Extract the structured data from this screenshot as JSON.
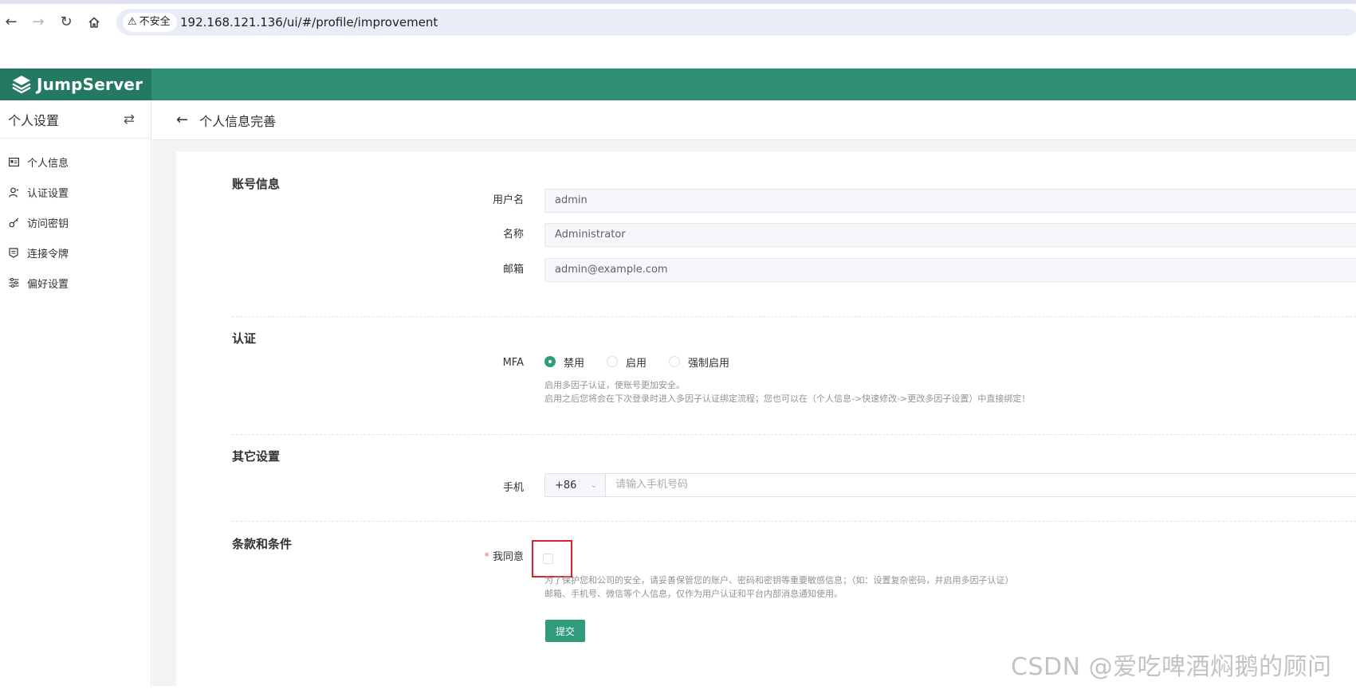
{
  "browser": {
    "insecure_label": "不安全",
    "url": "192.168.121.136/ui/#/profile/improvement"
  },
  "app": {
    "logo_text": "JumpServer",
    "colors": {
      "header": "#2f8f74",
      "logo_bg": "#247a61",
      "accent": "#2f9c7c",
      "highlight": "#e0202a"
    }
  },
  "sidebar": {
    "title": "个人设置",
    "items": [
      {
        "label": "个人信息",
        "icon": "id-card-icon"
      },
      {
        "label": "认证设置",
        "icon": "user-auth-icon"
      },
      {
        "label": "访问密钥",
        "icon": "key-icon"
      },
      {
        "label": "连接令牌",
        "icon": "token-icon"
      },
      {
        "label": "偏好设置",
        "icon": "sliders-icon"
      }
    ]
  },
  "page": {
    "title": "个人信息完善"
  },
  "account": {
    "section_title": "账号信息",
    "username_label": "用户名",
    "username_value": "admin",
    "name_label": "名称",
    "name_value": "Administrator",
    "email_label": "邮箱",
    "email_value": "admin@example.com"
  },
  "auth": {
    "section_title": "认证",
    "mfa_label": "MFA",
    "options": [
      "禁用",
      "启用",
      "强制启用"
    ],
    "selected": "禁用",
    "help_line1": "启用多因子认证，使账号更加安全。",
    "help_line2": "启用之后您将会在下次登录时进入多因子认证绑定流程；您也可以在（个人信息->快速修改->更改多因子设置）中直接绑定！"
  },
  "other": {
    "section_title": "其它设置",
    "phone_label": "手机",
    "phone_prefix": "+86",
    "phone_placeholder": "请输入手机号码"
  },
  "terms": {
    "section_title": "条款和条件",
    "required_mark": "*",
    "agree_label": "我同意",
    "help_line1": "为了保护您和公司的安全，请妥善保管您的账户、密码和密钥等重要敏感信息；（如：设置复杂密码，并启用多因子认证）",
    "help_line2": "邮箱、手机号、微信等个人信息，仅作为用户认证和平台内部消息通知使用。",
    "submit_label": "提交"
  },
  "watermark": "CSDN @爱吃啤酒焖鹅的顾问"
}
